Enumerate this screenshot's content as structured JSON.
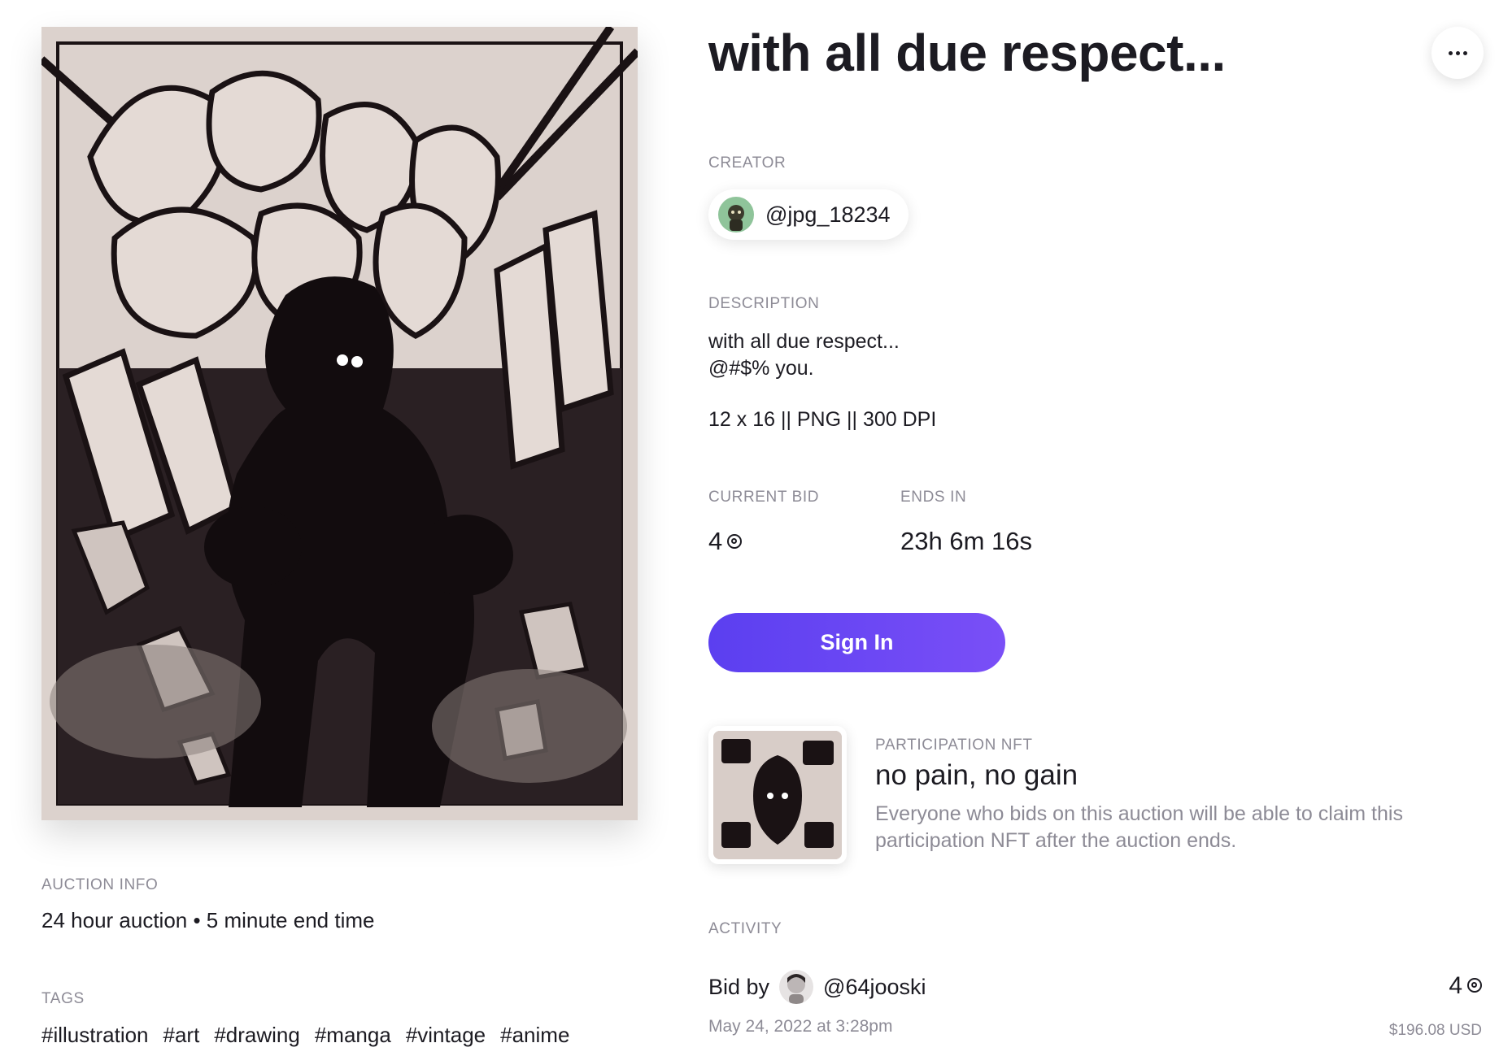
{
  "title": "with all due respect...",
  "menu_icon": "more-horizontal-icon",
  "creator": {
    "label": "CREATOR",
    "handle": "@jpg_18234"
  },
  "description": {
    "label": "DESCRIPTION",
    "lines": [
      "with all due respect...",
      "@#$% you.",
      "",
      "12 x 16 || PNG || 300 DPI"
    ]
  },
  "current_bid": {
    "label": "CURRENT BID",
    "value": "4",
    "currency_icon": "eth-circle-icon"
  },
  "ends_in": {
    "label": "ENDS IN",
    "value": "23h 6m 16s"
  },
  "sign_in_label": "Sign In",
  "participation_nft": {
    "label": "PARTICIPATION NFT",
    "title": "no pain, no gain",
    "text": "Everyone who bids on this auction will be able to claim this participation NFT after the auction ends."
  },
  "activity": {
    "label": "ACTIVITY",
    "items": [
      {
        "prefix": "Bid by",
        "user": "@64jooski",
        "date": "May 24, 2022 at 3:28pm",
        "amount": "4",
        "usd": "$196.08 USD"
      }
    ]
  },
  "auction_info": {
    "label": "AUCTION INFO",
    "text": "24 hour auction • 5 minute end time"
  },
  "tags": {
    "label": "TAGS",
    "items": [
      "#illustration",
      "#art",
      "#drawing",
      "#manga",
      "#vintage",
      "#anime"
    ]
  },
  "colors": {
    "accent_start": "#5b3ff0",
    "accent_end": "#7a4ff7",
    "text": "#1c1b22",
    "muted": "#8d8b96"
  }
}
